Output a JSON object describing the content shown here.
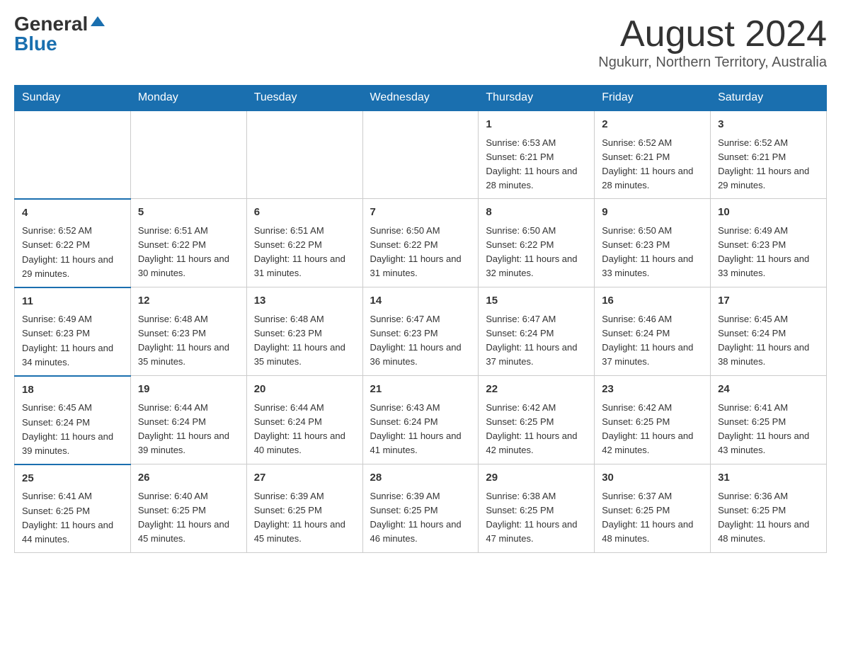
{
  "header": {
    "logo": {
      "general": "General",
      "blue": "Blue"
    },
    "title": "August 2024",
    "location": "Ngukurr, Northern Territory, Australia"
  },
  "weekdays": [
    "Sunday",
    "Monday",
    "Tuesday",
    "Wednesday",
    "Thursday",
    "Friday",
    "Saturday"
  ],
  "weeks": [
    [
      {
        "day": "",
        "info": ""
      },
      {
        "day": "",
        "info": ""
      },
      {
        "day": "",
        "info": ""
      },
      {
        "day": "",
        "info": ""
      },
      {
        "day": "1",
        "info": "Sunrise: 6:53 AM\nSunset: 6:21 PM\nDaylight: 11 hours and 28 minutes."
      },
      {
        "day": "2",
        "info": "Sunrise: 6:52 AM\nSunset: 6:21 PM\nDaylight: 11 hours and 28 minutes."
      },
      {
        "day": "3",
        "info": "Sunrise: 6:52 AM\nSunset: 6:21 PM\nDaylight: 11 hours and 29 minutes."
      }
    ],
    [
      {
        "day": "4",
        "info": "Sunrise: 6:52 AM\nSunset: 6:22 PM\nDaylight: 11 hours and 29 minutes."
      },
      {
        "day": "5",
        "info": "Sunrise: 6:51 AM\nSunset: 6:22 PM\nDaylight: 11 hours and 30 minutes."
      },
      {
        "day": "6",
        "info": "Sunrise: 6:51 AM\nSunset: 6:22 PM\nDaylight: 11 hours and 31 minutes."
      },
      {
        "day": "7",
        "info": "Sunrise: 6:50 AM\nSunset: 6:22 PM\nDaylight: 11 hours and 31 minutes."
      },
      {
        "day": "8",
        "info": "Sunrise: 6:50 AM\nSunset: 6:22 PM\nDaylight: 11 hours and 32 minutes."
      },
      {
        "day": "9",
        "info": "Sunrise: 6:50 AM\nSunset: 6:23 PM\nDaylight: 11 hours and 33 minutes."
      },
      {
        "day": "10",
        "info": "Sunrise: 6:49 AM\nSunset: 6:23 PM\nDaylight: 11 hours and 33 minutes."
      }
    ],
    [
      {
        "day": "11",
        "info": "Sunrise: 6:49 AM\nSunset: 6:23 PM\nDaylight: 11 hours and 34 minutes."
      },
      {
        "day": "12",
        "info": "Sunrise: 6:48 AM\nSunset: 6:23 PM\nDaylight: 11 hours and 35 minutes."
      },
      {
        "day": "13",
        "info": "Sunrise: 6:48 AM\nSunset: 6:23 PM\nDaylight: 11 hours and 35 minutes."
      },
      {
        "day": "14",
        "info": "Sunrise: 6:47 AM\nSunset: 6:23 PM\nDaylight: 11 hours and 36 minutes."
      },
      {
        "day": "15",
        "info": "Sunrise: 6:47 AM\nSunset: 6:24 PM\nDaylight: 11 hours and 37 minutes."
      },
      {
        "day": "16",
        "info": "Sunrise: 6:46 AM\nSunset: 6:24 PM\nDaylight: 11 hours and 37 minutes."
      },
      {
        "day": "17",
        "info": "Sunrise: 6:45 AM\nSunset: 6:24 PM\nDaylight: 11 hours and 38 minutes."
      }
    ],
    [
      {
        "day": "18",
        "info": "Sunrise: 6:45 AM\nSunset: 6:24 PM\nDaylight: 11 hours and 39 minutes."
      },
      {
        "day": "19",
        "info": "Sunrise: 6:44 AM\nSunset: 6:24 PM\nDaylight: 11 hours and 39 minutes."
      },
      {
        "day": "20",
        "info": "Sunrise: 6:44 AM\nSunset: 6:24 PM\nDaylight: 11 hours and 40 minutes."
      },
      {
        "day": "21",
        "info": "Sunrise: 6:43 AM\nSunset: 6:24 PM\nDaylight: 11 hours and 41 minutes."
      },
      {
        "day": "22",
        "info": "Sunrise: 6:42 AM\nSunset: 6:25 PM\nDaylight: 11 hours and 42 minutes."
      },
      {
        "day": "23",
        "info": "Sunrise: 6:42 AM\nSunset: 6:25 PM\nDaylight: 11 hours and 42 minutes."
      },
      {
        "day": "24",
        "info": "Sunrise: 6:41 AM\nSunset: 6:25 PM\nDaylight: 11 hours and 43 minutes."
      }
    ],
    [
      {
        "day": "25",
        "info": "Sunrise: 6:41 AM\nSunset: 6:25 PM\nDaylight: 11 hours and 44 minutes."
      },
      {
        "day": "26",
        "info": "Sunrise: 6:40 AM\nSunset: 6:25 PM\nDaylight: 11 hours and 45 minutes."
      },
      {
        "day": "27",
        "info": "Sunrise: 6:39 AM\nSunset: 6:25 PM\nDaylight: 11 hours and 45 minutes."
      },
      {
        "day": "28",
        "info": "Sunrise: 6:39 AM\nSunset: 6:25 PM\nDaylight: 11 hours and 46 minutes."
      },
      {
        "day": "29",
        "info": "Sunrise: 6:38 AM\nSunset: 6:25 PM\nDaylight: 11 hours and 47 minutes."
      },
      {
        "day": "30",
        "info": "Sunrise: 6:37 AM\nSunset: 6:25 PM\nDaylight: 11 hours and 48 minutes."
      },
      {
        "day": "31",
        "info": "Sunrise: 6:36 AM\nSunset: 6:25 PM\nDaylight: 11 hours and 48 minutes."
      }
    ]
  ]
}
